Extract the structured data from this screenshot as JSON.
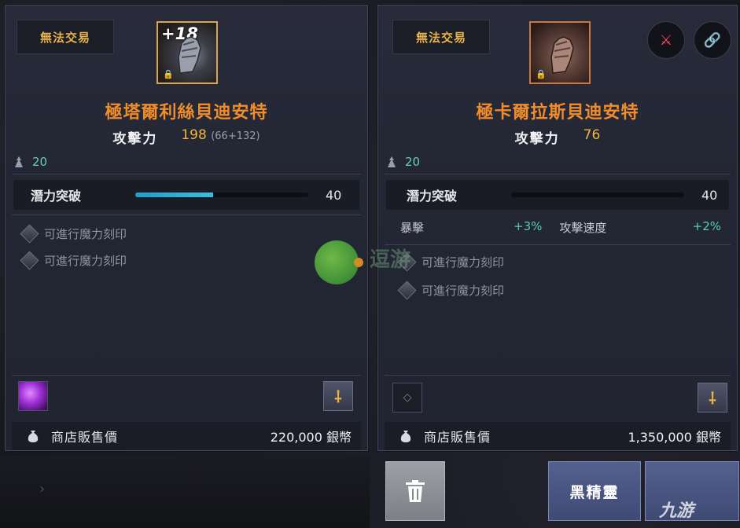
{
  "left_panel": {
    "tag": "無法交易",
    "enhance": "+18",
    "item_name": "極塔爾利絲貝迪安特",
    "stat_label": "攻擊力",
    "stat_value": "198",
    "stat_sub": "(66+132)",
    "level": "20",
    "potential_label": "潛力突破",
    "potential_value": "40",
    "potential_fill": 0.45,
    "engravings": [
      "可進行魔力刻印",
      "可進行魔力刻印"
    ],
    "sell_label": "商店販售價",
    "sell_value": "220,000 銀幣"
  },
  "right_panel": {
    "tag": "無法交易",
    "item_name": "極卡爾拉斯貝迪安特",
    "stat_label": "攻擊力",
    "stat_value": "76",
    "level": "20",
    "potential_label": "潛力突破",
    "potential_value": "40",
    "potential_fill": 0,
    "bonus": [
      {
        "label": "暴擊",
        "value": "+3%"
      },
      {
        "label": "攻擊速度",
        "value": "+2%"
      }
    ],
    "engravings": [
      "可進行魔力刻印",
      "可進行魔力刻印"
    ],
    "sell_label": "商店販售價",
    "sell_value": "1,350,000 銀幣"
  },
  "buttons": {
    "dark_elf": "黑精靈"
  },
  "watermarks": {
    "doyo": "逗游",
    "jiuyou": "九游"
  },
  "colors": {
    "item_name": "#f08d2a",
    "tag": "#e7b14b",
    "level": "#63d1bd",
    "bonus": "#56d0ad",
    "potential_bar": "#1ea0c8"
  }
}
